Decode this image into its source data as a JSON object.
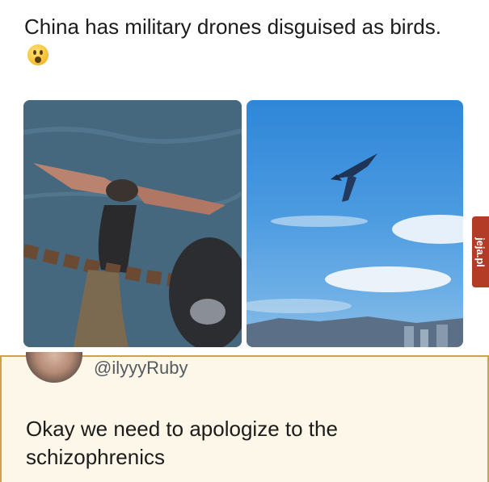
{
  "post": {
    "caption": "China has military drones disguised as birds.",
    "emoji": "astonished-face-icon"
  },
  "images": {
    "left": "bird-on-chain-photo",
    "right": "bird-in-sky-photo"
  },
  "watermark": {
    "text": "jeja.pl",
    "color": "#b33c26"
  },
  "tweet": {
    "handle": "@ilyyyRuby",
    "text": "Okay we need to apologize to the schizophrenics"
  },
  "colors": {
    "accent_border": "#c9a44a",
    "tweet_bg": "#fcf7e8"
  }
}
